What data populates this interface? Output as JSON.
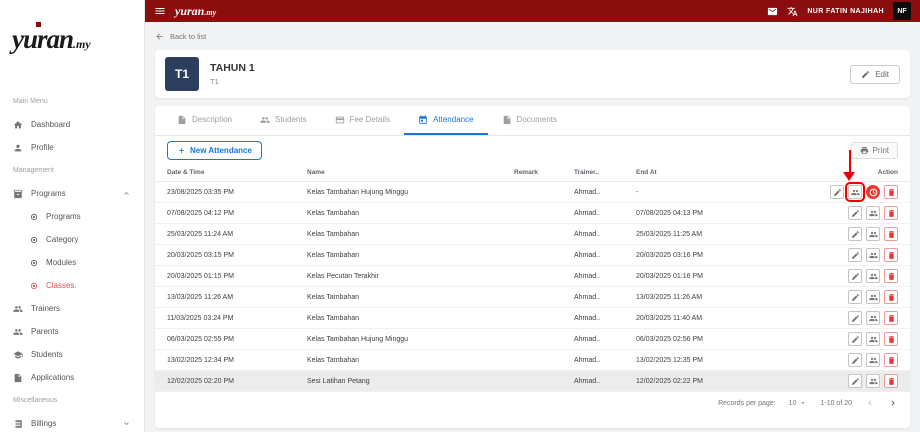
{
  "colors": {
    "brand_maroon": "#8a0e0e",
    "accent_blue": "#1976d2",
    "danger_red": "#e53935",
    "annotation_red": "#ee0000",
    "active_item_red": "#d9534f",
    "avatar_navy": "#2c3e5d"
  },
  "topbar": {
    "logo": "yuran",
    "logo_suffix": ".my",
    "user_name": "NUR FATIN NAJIHAH",
    "avatar_initials": "NF"
  },
  "sidebar": {
    "logo": "yuran",
    "logo_suffix": ".my",
    "section_main": "Main Menu",
    "dashboard": "Dashboard",
    "profile": "Profile",
    "section_management": "Management",
    "programs": "Programs",
    "programs_children": [
      {
        "label": "Programs",
        "active": false
      },
      {
        "label": "Category",
        "active": false
      },
      {
        "label": "Modules",
        "active": false
      },
      {
        "label": "Classes.",
        "active": true
      }
    ],
    "trainers": "Trainers",
    "parents": "Parents",
    "students": "Students",
    "applications": "Applications",
    "section_misc": "Miscellaneous",
    "billings": "Billings"
  },
  "page": {
    "back_link": "Back to list",
    "class_avatar": "T1",
    "class_title": "TAHUN 1",
    "class_subtitle": "T1",
    "edit_button": "Edit",
    "tabs": [
      {
        "label": "Description"
      },
      {
        "label": "Students"
      },
      {
        "label": "Fee Details"
      },
      {
        "label": "Attendance"
      },
      {
        "label": "Documents"
      }
    ],
    "active_tab": "Attendance",
    "new_attendance_button": "New Attendance",
    "print_button": "Print"
  },
  "table": {
    "columns": [
      "Date & Time",
      "Name",
      "Remark",
      "Trainer..",
      "End At",
      "Action"
    ],
    "rows": [
      {
        "date_time": "23/08/2025 03:35 PM",
        "name": "Kelas Tambahan Hujung Minggu",
        "remark": "",
        "trainer": "Ahmad..",
        "end_at": "-",
        "actions": [
          "edit",
          "mark-attendance",
          "clock-out",
          "delete"
        ],
        "annotated_action": "mark-attendance",
        "highlighted": false
      },
      {
        "date_time": "07/08/2025 04:12 PM",
        "name": "Kelas Tambahan",
        "remark": "",
        "trainer": "Ahmad..",
        "end_at": "07/08/2025 04:13 PM",
        "actions": [
          "edit",
          "mark-attendance",
          "delete"
        ],
        "highlighted": false
      },
      {
        "date_time": "25/03/2025 11:24 AM",
        "name": "Kelas Tambahan",
        "remark": "",
        "trainer": "Ahmad..",
        "end_at": "25/03/2025 11:25 AM",
        "actions": [
          "edit",
          "mark-attendance",
          "delete"
        ],
        "highlighted": false
      },
      {
        "date_time": "20/03/2025 03:15 PM",
        "name": "Kelas Tambahan",
        "remark": "",
        "trainer": "Ahmad..",
        "end_at": "20/03/2025 03:16 PM",
        "actions": [
          "edit",
          "mark-attendance",
          "delete"
        ],
        "highlighted": false
      },
      {
        "date_time": "20/03/2025 01:15 PM",
        "name": "Kelas Pecutan Terakhir",
        "remark": "",
        "trainer": "Ahmad..",
        "end_at": "20/03/2025 01:16 PM",
        "actions": [
          "edit",
          "mark-attendance",
          "delete"
        ],
        "highlighted": false
      },
      {
        "date_time": "13/03/2025 11:26 AM",
        "name": "Kelas Tambahan",
        "remark": "",
        "trainer": "Ahmad..",
        "end_at": "13/03/2025 11:26 AM",
        "actions": [
          "edit",
          "mark-attendance",
          "delete"
        ],
        "highlighted": false
      },
      {
        "date_time": "11/03/2025 03:24 PM",
        "name": "Kelas Tambahan",
        "remark": "",
        "trainer": "Ahmad..",
        "end_at": "20/03/2025 11:40 AM",
        "actions": [
          "edit",
          "mark-attendance",
          "delete"
        ],
        "highlighted": false
      },
      {
        "date_time": "06/03/2025 02:55 PM",
        "name": "Kelas Tambahan Hujung Minggu",
        "remark": "",
        "trainer": "Ahmad..",
        "end_at": "06/03/2025 02:56 PM",
        "actions": [
          "edit",
          "mark-attendance",
          "delete"
        ],
        "highlighted": false
      },
      {
        "date_time": "13/02/2025 12:34 PM",
        "name": "Kelas Tambahan",
        "remark": "",
        "trainer": "Ahmad..",
        "end_at": "13/02/2025 12:35 PM",
        "actions": [
          "edit",
          "mark-attendance",
          "delete"
        ],
        "highlighted": false
      },
      {
        "date_time": "12/02/2025 02:20 PM",
        "name": "Sesi Latihan Petang",
        "remark": "",
        "trainer": "Ahmad..",
        "end_at": "12/02/2025 02:22 PM",
        "actions": [
          "edit",
          "mark-attendance",
          "delete"
        ],
        "highlighted": true
      }
    ]
  },
  "pagination": {
    "records_per_page_label": "Records per page:",
    "records_per_page_value": "10",
    "range_label": "1-10 of 20"
  },
  "annotation": {
    "shape": "red-arrow-down-with-box",
    "color": "#ee0000",
    "target": "first-row mark-attendance action icon"
  }
}
